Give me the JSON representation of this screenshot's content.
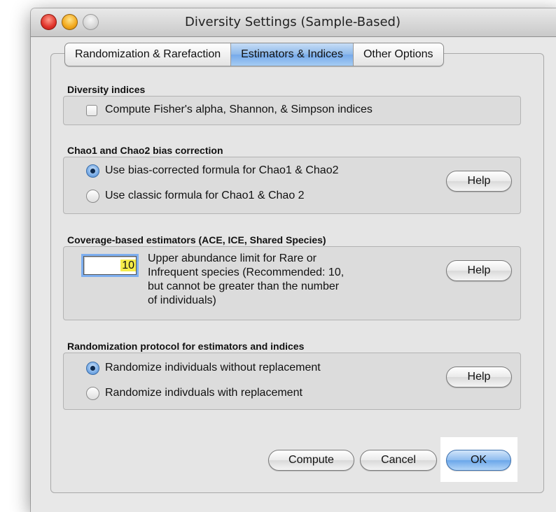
{
  "window": {
    "title": "Diversity Settings (Sample-Based)"
  },
  "tabs": [
    {
      "label": "Randomization & Rarefaction",
      "active": false
    },
    {
      "label": "Estimators & Indices",
      "active": true
    },
    {
      "label": "Other Options",
      "active": false
    }
  ],
  "diversity_indices": {
    "label": "Diversity indices",
    "checkbox_label": "Compute Fisher's alpha, Shannon, & Simpson indices",
    "checked": false
  },
  "bias_correction": {
    "label": "Chao1 and Chao2 bias correction",
    "options": [
      {
        "label": "Use bias-corrected formula for Chao1 & Chao2",
        "selected": true
      },
      {
        "label": "Use classic formula for Chao1 & Chao 2",
        "selected": false
      }
    ],
    "help_label": "Help"
  },
  "coverage": {
    "label": "Coverage-based estimators (ACE, ICE, Shared Species)",
    "value": "10",
    "description_lines": [
      "Upper abundance limit for Rare or",
      "Infrequent species (Recommended: 10,",
      "but cannot be greater than the number",
      "of individuals)"
    ],
    "help_label": "Help"
  },
  "randomization": {
    "label": "Randomization protocol for estimators and indices",
    "options": [
      {
        "label": "Randomize individuals without replacement",
        "selected": true
      },
      {
        "label": "Randomize indivduals with replacement",
        "selected": false
      }
    ],
    "help_label": "Help"
  },
  "buttons": {
    "compute": "Compute",
    "cancel": "Cancel",
    "ok": "OK"
  }
}
